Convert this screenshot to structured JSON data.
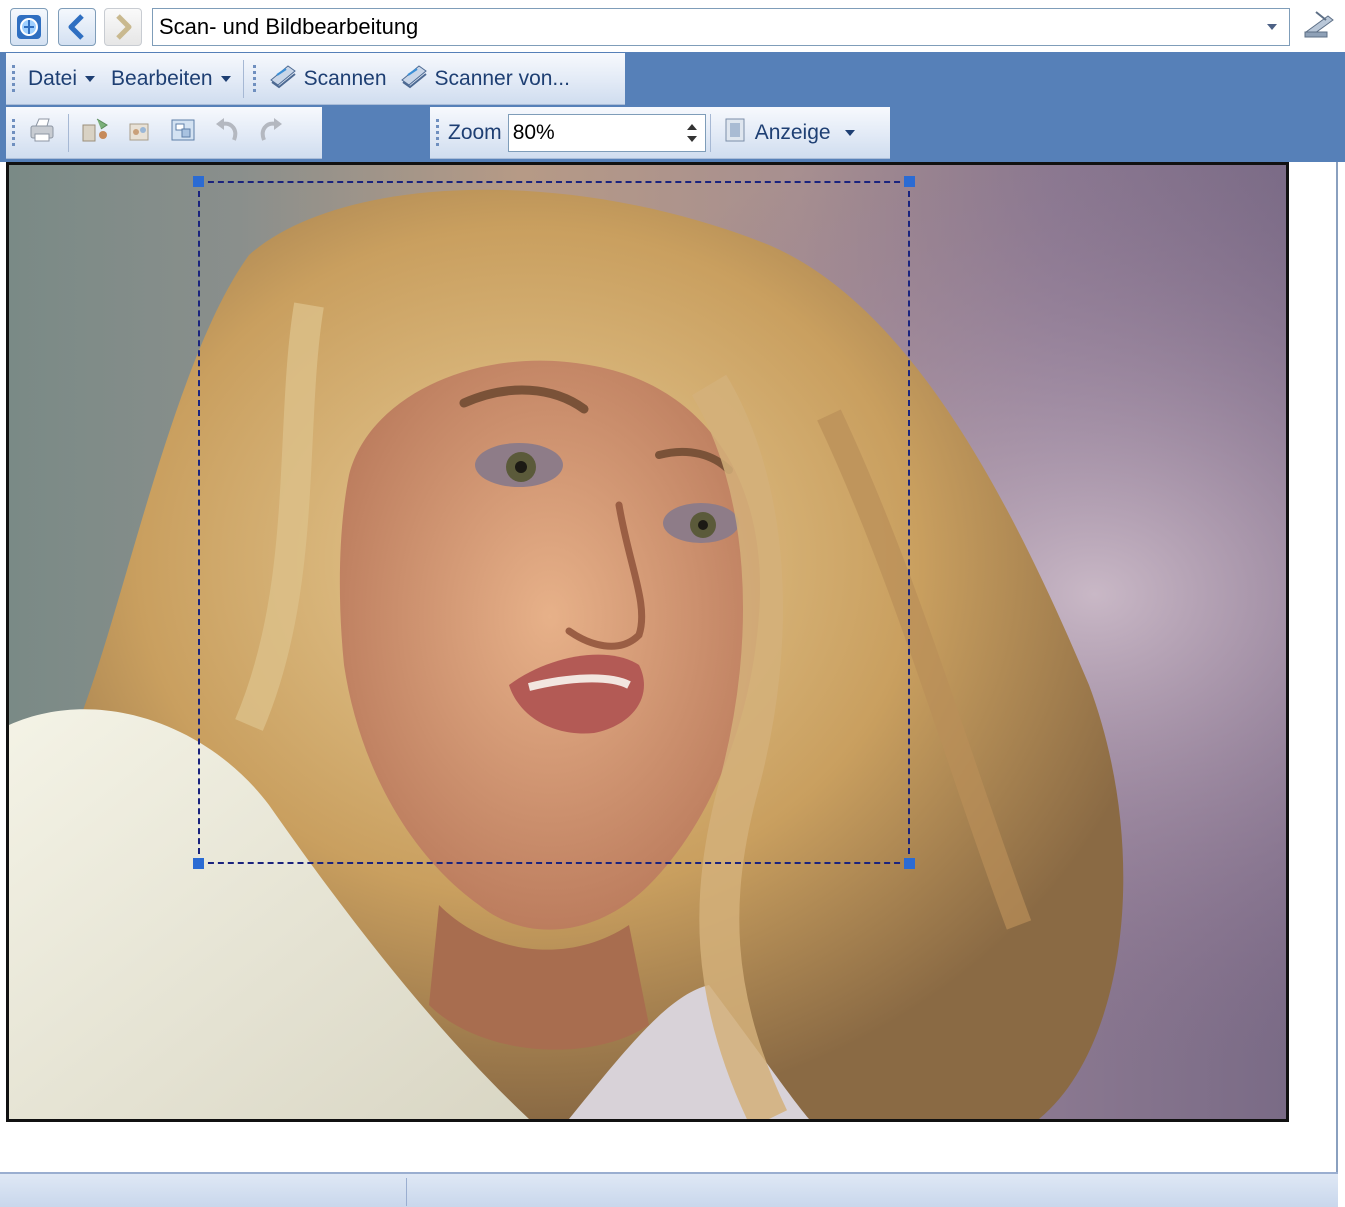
{
  "address_bar": {
    "location": "Scan- und Bildbearbeitung"
  },
  "menu": {
    "items": [
      {
        "label": "Datei"
      },
      {
        "label": "Bearbeiten"
      }
    ]
  },
  "scan_toolbar": {
    "scan_label": "Scannen",
    "scan_from_label": "Scanner von..."
  },
  "image_toolbar": {
    "icons": [
      "print-icon",
      "rotate-tools-icon",
      "adjust-icon",
      "fit-icon",
      "undo-icon",
      "redo-icon"
    ]
  },
  "zoom": {
    "label": "Zoom",
    "value": "80%"
  },
  "view": {
    "label": "Anzeige"
  },
  "status": {
    "left": "",
    "right": ""
  },
  "colors": {
    "band": "#5680b8",
    "text_blue": "#1e3f73",
    "selection": "#1a237e",
    "handle": "#2b6bd3"
  }
}
